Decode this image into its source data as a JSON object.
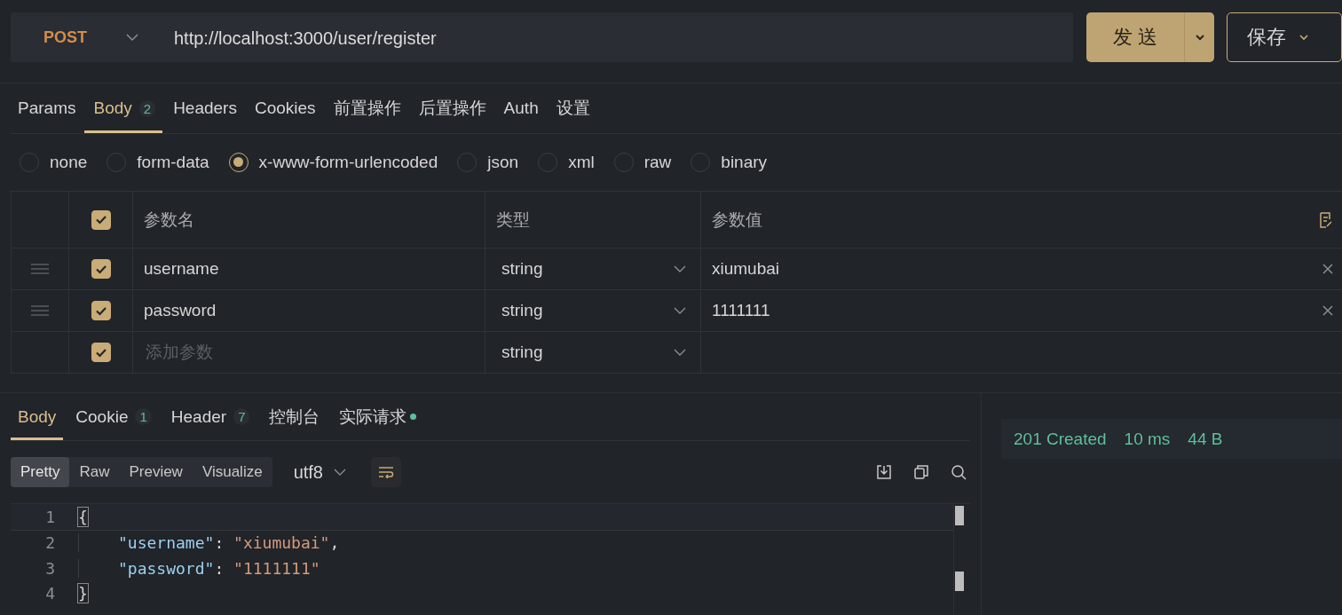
{
  "request": {
    "method": "POST",
    "url": "http://localhost:3000/user/register",
    "send_label": "发 送",
    "save_label": "保存"
  },
  "request_tabs": [
    {
      "label": "Params",
      "selected": false
    },
    {
      "label": "Body",
      "badge": "2",
      "selected": true
    },
    {
      "label": "Headers",
      "selected": false
    },
    {
      "label": "Cookies",
      "selected": false
    },
    {
      "label": "前置操作",
      "selected": false
    },
    {
      "label": "后置操作",
      "selected": false
    },
    {
      "label": "Auth",
      "selected": false
    },
    {
      "label": "设置",
      "selected": false
    }
  ],
  "body_types": [
    {
      "label": "none",
      "selected": false
    },
    {
      "label": "form-data",
      "selected": false
    },
    {
      "label": "x-www-form-urlencoded",
      "selected": true
    },
    {
      "label": "json",
      "selected": false
    },
    {
      "label": "xml",
      "selected": false
    },
    {
      "label": "raw",
      "selected": false
    },
    {
      "label": "binary",
      "selected": false
    }
  ],
  "params_table": {
    "header_checked": true,
    "columns": [
      "参数名",
      "类型",
      "参数值"
    ],
    "rows": [
      {
        "name": "username",
        "type": "string",
        "value": "xiumubai",
        "checked": true
      },
      {
        "name": "password",
        "type": "string",
        "value": "1111111",
        "checked": true
      }
    ],
    "new_row": {
      "placeholder": "添加参数",
      "type": "string",
      "checked": true
    }
  },
  "response_tabs": [
    {
      "label": "Body",
      "selected": true,
      "dot": false
    },
    {
      "label": "Cookie",
      "badge": "1",
      "selected": false,
      "dot": false
    },
    {
      "label": "Header",
      "badge": "7",
      "selected": false,
      "dot": false
    },
    {
      "label": "控制台",
      "selected": false,
      "dot": false
    },
    {
      "label": "实际请求",
      "selected": false,
      "dot": true
    }
  ],
  "view_modes": [
    {
      "label": "Pretty",
      "selected": true
    },
    {
      "label": "Raw",
      "selected": false
    },
    {
      "label": "Preview",
      "selected": false
    },
    {
      "label": "Visualize",
      "selected": false
    }
  ],
  "encoding": "utf8",
  "code_lines": [
    {
      "number": "1",
      "current": true,
      "indented": false,
      "tokens": [
        {
          "kind": "punct",
          "text": "{",
          "highlight": true
        }
      ]
    },
    {
      "number": "2",
      "current": false,
      "indented": true,
      "tokens": [
        {
          "kind": "key",
          "text": "\"username\"",
          "highlight": false
        },
        {
          "kind": "punct",
          "text": ":",
          "highlight": false
        },
        {
          "kind": "string",
          "text": "\"xiumubai\"",
          "highlight": false
        },
        {
          "kind": "punct",
          "text": ",",
          "highlight": false
        }
      ]
    },
    {
      "number": "3",
      "current": false,
      "indented": true,
      "tokens": [
        {
          "kind": "key",
          "text": "\"password\"",
          "highlight": false
        },
        {
          "kind": "punct",
          "text": ":",
          "highlight": false
        },
        {
          "kind": "string",
          "text": "\"1111111\"",
          "highlight": false
        }
      ]
    },
    {
      "number": "4",
      "current": false,
      "indented": false,
      "tokens": [
        {
          "kind": "punct",
          "text": "}",
          "highlight": true
        }
      ]
    }
  ],
  "status": {
    "code": "201 Created",
    "time": "10 ms",
    "size": "44 B"
  }
}
